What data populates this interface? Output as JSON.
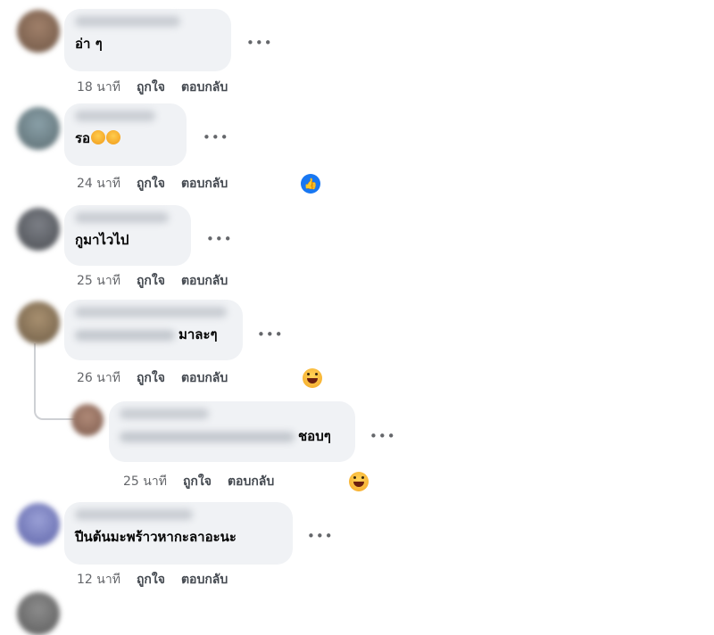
{
  "comments": [
    {
      "text": "อ่า ๆ",
      "time": "18 นาที",
      "like": "ถูกใจ",
      "reply": "ตอบกลับ"
    },
    {
      "text": "รอ",
      "time": "24 นาที",
      "like": "ถูกใจ",
      "reply": "ตอบกลับ",
      "reaction": "like-icon"
    },
    {
      "text": "กูมาไวไป",
      "time": "25 นาที",
      "like": "ถูกใจ",
      "reply": "ตอบกลับ"
    },
    {
      "text": "มาละๆ",
      "time": "26 นาที",
      "like": "ถูกใจ",
      "reply": "ตอบกลับ",
      "reaction": "grinning-face-icon"
    },
    {
      "text": "ชอบๆ",
      "time": "25 นาที",
      "like": "ถูกใจ",
      "reply": "ตอบกลับ",
      "reaction": "grinning-face-icon"
    },
    {
      "text": "ปีนต้นมะพร้าวหากะลาอะนะ",
      "time": "12 นาที",
      "like": "ถูกใจ",
      "reply": "ตอบกลับ"
    }
  ],
  "more_glyph": "•••",
  "colors": {
    "bubble": "#f0f2f5",
    "meta": "#65676b",
    "like_blue": "#1877f2"
  }
}
